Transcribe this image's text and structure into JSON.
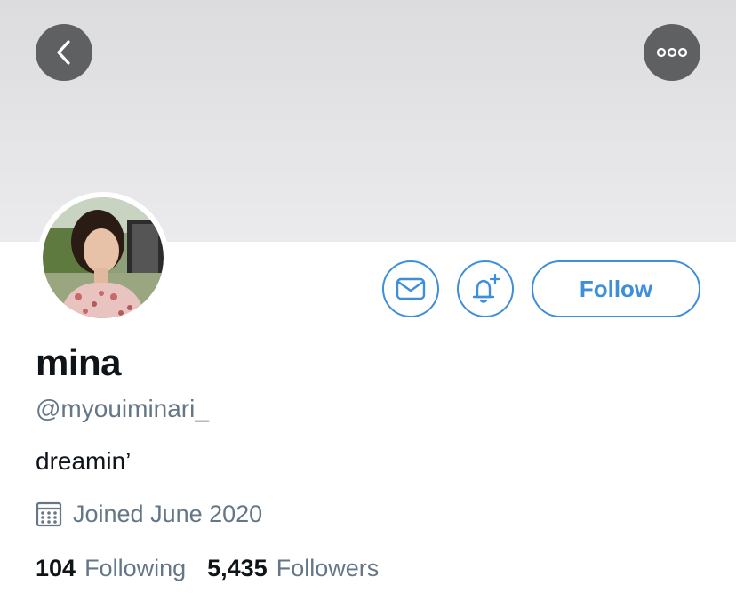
{
  "header": {
    "back_icon": "chevron-left-icon",
    "more_icon": "more-horizontal-icon"
  },
  "profile": {
    "display_name": "mina",
    "handle": "@myouiminari_",
    "bio": "dreamin’",
    "joined": "Joined June 2020",
    "avatar_icon": "profile-photo"
  },
  "actions": {
    "message_icon": "envelope-icon",
    "notify_icon": "bell-plus-icon",
    "follow_label": "Follow"
  },
  "stats": {
    "following_count": "104",
    "following_label": "Following",
    "followers_count": "5,435",
    "followers_label": "Followers"
  },
  "colors": {
    "accent": "#3d8fd9",
    "secondary_text": "#657786",
    "primary_text": "#0f1419",
    "overlay_button": "#5f6062"
  }
}
